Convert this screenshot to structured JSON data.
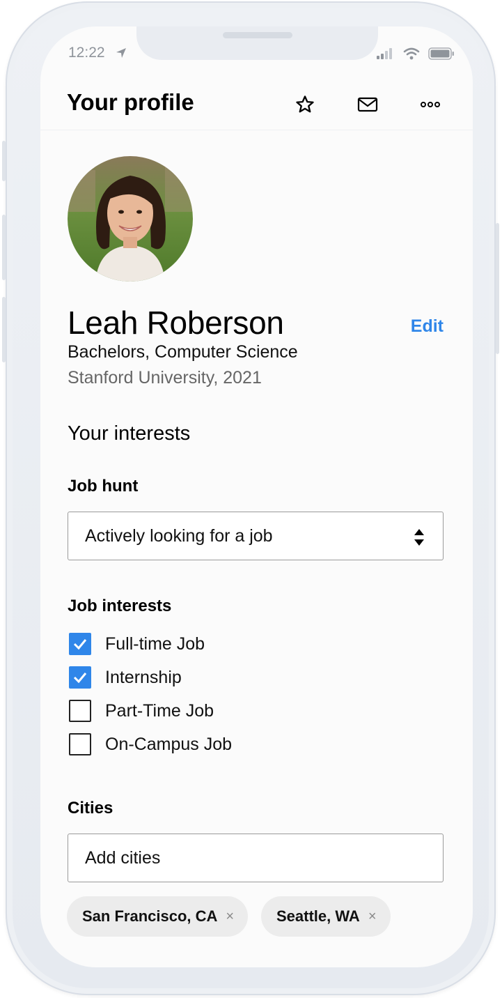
{
  "status_bar": {
    "time": "12:22"
  },
  "header": {
    "title": "Your profile",
    "icons": [
      "star-icon",
      "mail-icon",
      "more-icon"
    ]
  },
  "profile": {
    "name": "Leah Roberson",
    "edit_label": "Edit",
    "degree": "Bachelors, Computer Science",
    "school": "Stanford University, 2021"
  },
  "interests": {
    "title": "Your interests",
    "job_hunt_label": "Job hunt",
    "job_hunt_value": "Actively looking for a job",
    "job_interests_label": "Job interests",
    "job_interests": [
      {
        "label": "Full-time Job",
        "checked": true
      },
      {
        "label": "Internship",
        "checked": true
      },
      {
        "label": "Part-Time Job",
        "checked": false
      },
      {
        "label": "On-Campus Job",
        "checked": false
      }
    ],
    "cities_label": "Cities",
    "cities_placeholder": "Add cities",
    "cities": [
      {
        "label": "San Francisco, CA",
        "remove": "×"
      },
      {
        "label": "Seattle, WA",
        "remove": "×"
      }
    ]
  },
  "colors": {
    "accent": "#2f86e9",
    "chip": "#ececec",
    "muted_text": "#666666"
  }
}
